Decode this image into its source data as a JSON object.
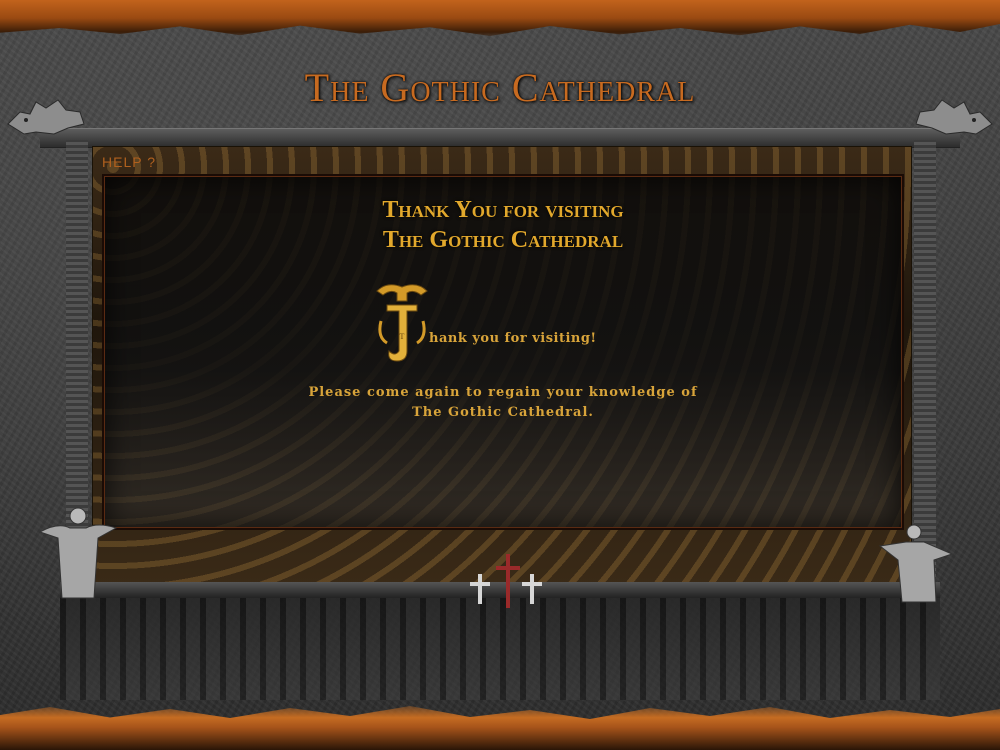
{
  "header": {
    "title": "The Gothic Cathedral"
  },
  "help": {
    "label": "HELP ?"
  },
  "panel": {
    "heading_line1": "Thank You for visiting",
    "heading_line2": "The Gothic Cathedral",
    "dropcap_letter": "T",
    "dropcap_rest": "hank you for visiting!",
    "message_line1": "Please come again to regain your knowledge of",
    "message_line2": "The Gothic Cathedral."
  },
  "colors": {
    "accent": "#e2a82c",
    "title": "#c76a20",
    "frame": "#c2631c"
  },
  "icons": [
    "gargoyle-left-icon",
    "gargoyle-right-icon",
    "statue-left-icon",
    "statue-right-icon",
    "cross-icon"
  ]
}
